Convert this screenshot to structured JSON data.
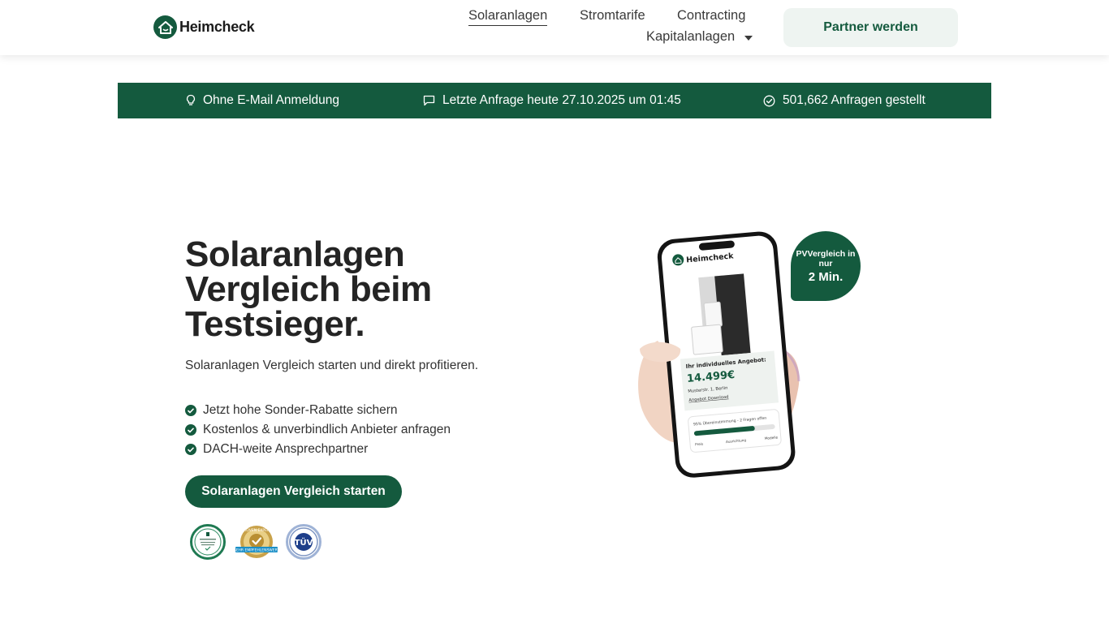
{
  "header": {
    "brand": "Heimcheck",
    "nav": {
      "solar": "Solaranlagen",
      "strom": "Stromtarife",
      "contracting": "Contracting",
      "kapital": "Kapitalanlagen"
    },
    "partner_label": "Partner werden"
  },
  "infobar": {
    "item1": "Ohne E-Mail Anmeldung",
    "item2": "Letzte Anfrage heute 27.10.2025 um 01:45",
    "item3": "501,662 Anfragen gestellt"
  },
  "hero": {
    "title_line1": "Solaranlagen",
    "title_line2": "Vergleich beim",
    "title_line3": "Testsieger.",
    "subtitle": "Solaranlagen Vergleich starten und direkt profitieren.",
    "benefits": [
      "Jetzt hohe Sonder-Rabatte sichern",
      "Kostenlos & unverbindlich Anbieter anfragen",
      "DACH-weite Ansprechpartner"
    ],
    "cta_label": "Solaranlagen Vergleich starten"
  },
  "phone": {
    "brand": "Heimcheck",
    "offer_title": "Ihr individuelles Angebot:",
    "price": "14.499€",
    "address": "Musterstr. 1, Berlin",
    "download": "Angebot Download",
    "match": "95% Übereinstimmung - 2 Fragen offen",
    "steps": [
      "Preis",
      "Ausrichtung",
      "Modelle"
    ],
    "match_progress": 0.75
  },
  "bubble": {
    "line1": "PVVergleich in nur",
    "line2": "2 Min."
  },
  "badges": {
    "proven": "PROVEN EXPERT",
    "tuv": "TÜV"
  },
  "colors": {
    "brand_green": "#145a3e",
    "partner_bg": "#eef4f1"
  }
}
